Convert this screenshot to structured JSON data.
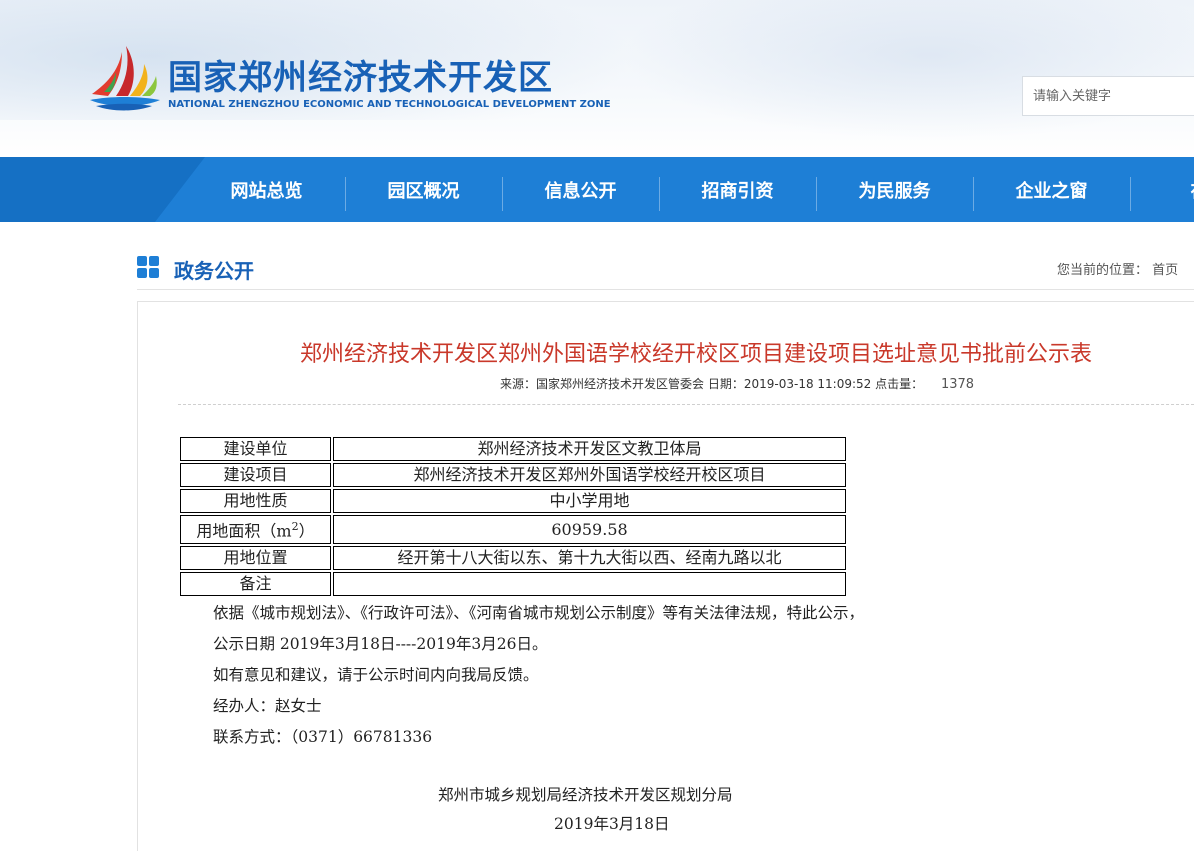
{
  "header": {
    "title_cn": "国家郑州经济技术开发区",
    "title_en": "NATIONAL ZHENGZHOU ECONOMIC AND TECHNOLOGICAL DEVELOPMENT ZONE",
    "logo_icon": "sailboat-logo-icon",
    "search_placeholder": "请输入关键字"
  },
  "nav": {
    "items": [
      {
        "label": "网站总览"
      },
      {
        "label": "园区概况"
      },
      {
        "label": "信息公开"
      },
      {
        "label": "招商引资"
      },
      {
        "label": "为民服务"
      },
      {
        "label": "企业之窗"
      },
      {
        "label": "在线"
      }
    ]
  },
  "section": {
    "title": "政务公开",
    "icon": "grid-icon",
    "location_label": "您当前的位置：",
    "location_home": "首页"
  },
  "article": {
    "title": "郑州经济技术开发区郑州外国语学校经开校区项目建设项目选址意见书批前公示表",
    "meta_source": "来源：国家郑州经济技术开发区管委会",
    "meta_date": "日期：2019-03-18 11:09:52",
    "meta_clicks_label": "点击量：",
    "meta_clicks": "1378",
    "table": [
      {
        "key": "建设单位",
        "value": "郑州经济技术开发区文教卫体局"
      },
      {
        "key": "建设项目",
        "value": "郑州经济技术开发区郑州外国语学校经开校区项目"
      },
      {
        "key": "用地性质",
        "value": "中小学用地"
      },
      {
        "key": "用地面积（m",
        "key_sup": "2",
        "key_suffix": "）",
        "value": "60959.58"
      },
      {
        "key": "用地位置",
        "value": "经开第十八大街以东、第十九大街以西、经南九路以北"
      },
      {
        "key": "备注",
        "value": ""
      }
    ],
    "paragraphs": [
      "依据《城市规划法》、《行政许可法》、《河南省城市规划公示制度》等有关法律法规，特此公示，",
      "公示日期 2019年3月18日----2019年3月26日。",
      "如有意见和建议，请于公示时间内向我局反馈。",
      "经办人：赵女士",
      "联系方式：（0371）66781336"
    ],
    "signature": "郑州市城乡规划局经济技术开发区规划分局",
    "signature_date": "2019年3月18日"
  },
  "colors": {
    "brand_blue": "#1861b6",
    "nav_blue": "#1e7fd6",
    "title_red": "#c9382a"
  }
}
